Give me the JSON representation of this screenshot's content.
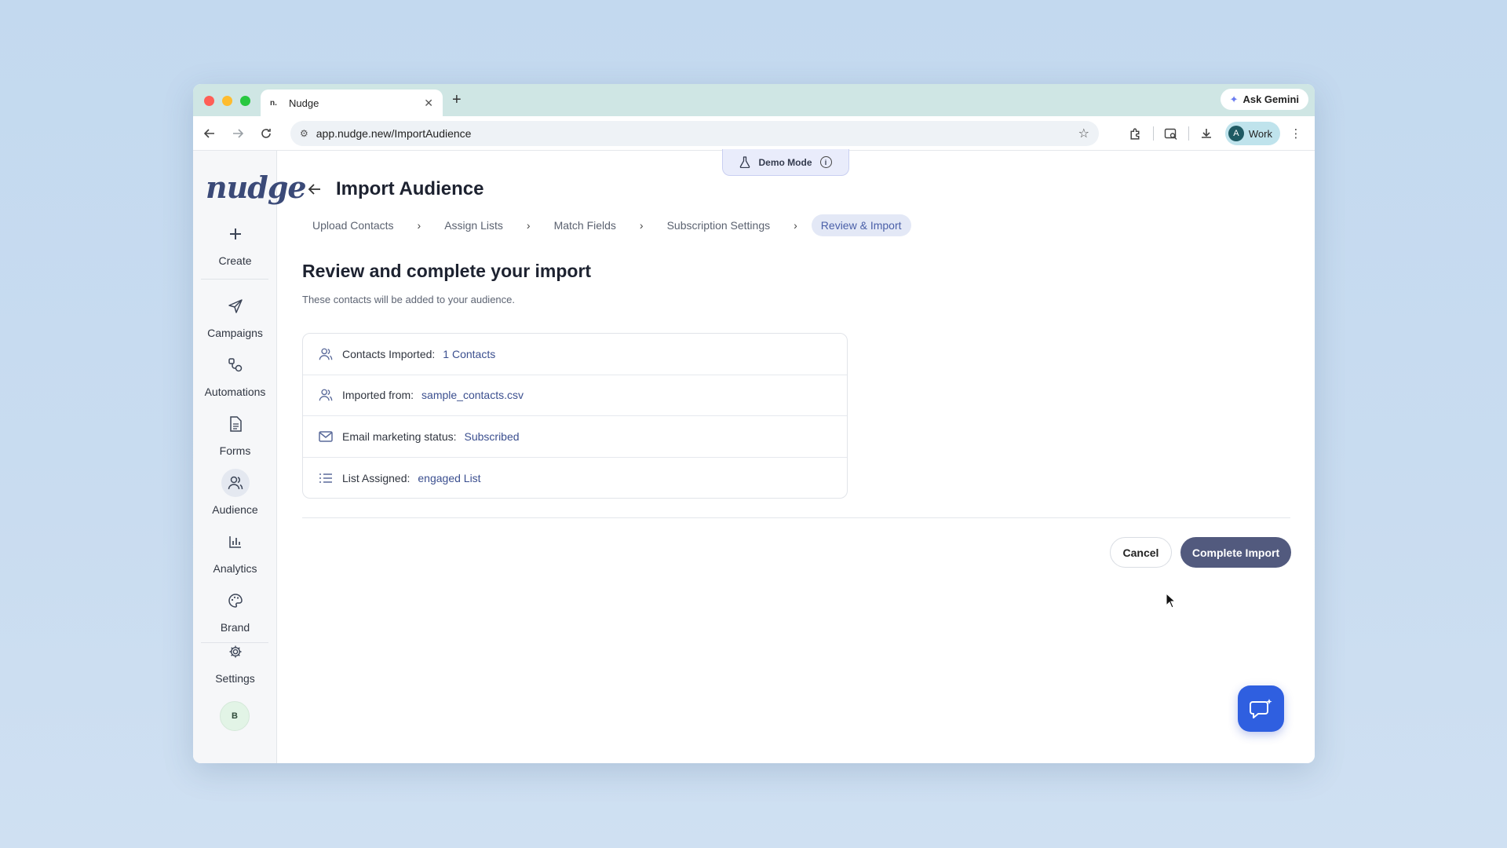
{
  "browser": {
    "tab_title": "Nudge",
    "tab_favicon": "n.",
    "new_tab": "+",
    "gemini_label": "Ask Gemini",
    "url": "app.nudge.new/ImportAudience",
    "profile_initial": "A",
    "profile_label": "Work"
  },
  "app": {
    "logo": "nudge",
    "demo_label": "Demo Mode"
  },
  "sidebar": {
    "create": "Create",
    "items": [
      {
        "label": "Campaigns",
        "icon": "send-icon"
      },
      {
        "label": "Automations",
        "icon": "automation-icon"
      },
      {
        "label": "Forms",
        "icon": "document-icon"
      },
      {
        "label": "Audience",
        "icon": "users-icon"
      },
      {
        "label": "Analytics",
        "icon": "bar-chart-icon"
      },
      {
        "label": "Brand",
        "icon": "palette-icon"
      }
    ],
    "settings": "Settings",
    "avatar": "B"
  },
  "page": {
    "title": "Import Audience",
    "steps": [
      "Upload Contacts",
      "Assign Lists",
      "Match Fields",
      "Subscription Settings",
      "Review & Import"
    ],
    "active_step": 4,
    "section_title": "Review and complete your import",
    "section_subtitle": "These contacts will be added to your audience."
  },
  "summary": [
    {
      "label": "Contacts Imported:",
      "value": "1 Contacts",
      "icon": "users-icon"
    },
    {
      "label": "Imported from:",
      "value": "sample_contacts.csv",
      "icon": "users-icon"
    },
    {
      "label": "Email marketing status:",
      "value": "Subscribed",
      "icon": "mail-icon"
    },
    {
      "label": "List Assigned:",
      "value": "engaged List",
      "icon": "list-icon"
    }
  ],
  "actions": {
    "cancel": "Cancel",
    "complete": "Complete Import"
  },
  "colors": {
    "primary_button": "#525a7e",
    "accent_value": "#3b4f8f",
    "chat_fab": "#2f5fe0"
  }
}
